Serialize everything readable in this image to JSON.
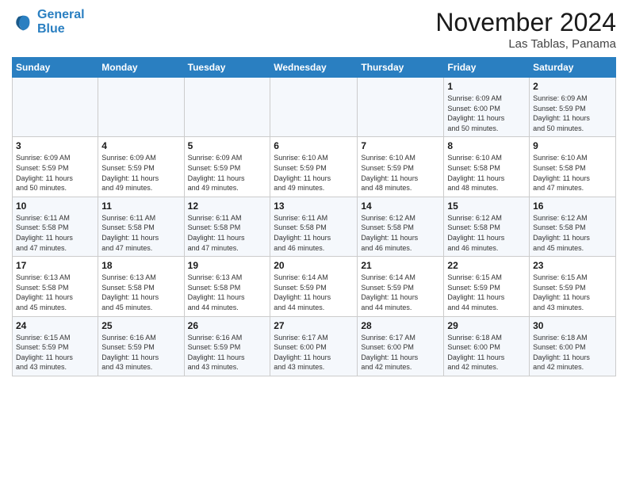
{
  "logo": {
    "line1": "General",
    "line2": "Blue"
  },
  "title": "November 2024",
  "location": "Las Tablas, Panama",
  "days_header": [
    "Sunday",
    "Monday",
    "Tuesday",
    "Wednesday",
    "Thursday",
    "Friday",
    "Saturday"
  ],
  "weeks": [
    [
      {
        "num": "",
        "info": ""
      },
      {
        "num": "",
        "info": ""
      },
      {
        "num": "",
        "info": ""
      },
      {
        "num": "",
        "info": ""
      },
      {
        "num": "",
        "info": ""
      },
      {
        "num": "1",
        "info": "Sunrise: 6:09 AM\nSunset: 6:00 PM\nDaylight: 11 hours\nand 50 minutes."
      },
      {
        "num": "2",
        "info": "Sunrise: 6:09 AM\nSunset: 5:59 PM\nDaylight: 11 hours\nand 50 minutes."
      }
    ],
    [
      {
        "num": "3",
        "info": "Sunrise: 6:09 AM\nSunset: 5:59 PM\nDaylight: 11 hours\nand 50 minutes."
      },
      {
        "num": "4",
        "info": "Sunrise: 6:09 AM\nSunset: 5:59 PM\nDaylight: 11 hours\nand 49 minutes."
      },
      {
        "num": "5",
        "info": "Sunrise: 6:09 AM\nSunset: 5:59 PM\nDaylight: 11 hours\nand 49 minutes."
      },
      {
        "num": "6",
        "info": "Sunrise: 6:10 AM\nSunset: 5:59 PM\nDaylight: 11 hours\nand 49 minutes."
      },
      {
        "num": "7",
        "info": "Sunrise: 6:10 AM\nSunset: 5:59 PM\nDaylight: 11 hours\nand 48 minutes."
      },
      {
        "num": "8",
        "info": "Sunrise: 6:10 AM\nSunset: 5:58 PM\nDaylight: 11 hours\nand 48 minutes."
      },
      {
        "num": "9",
        "info": "Sunrise: 6:10 AM\nSunset: 5:58 PM\nDaylight: 11 hours\nand 47 minutes."
      }
    ],
    [
      {
        "num": "10",
        "info": "Sunrise: 6:11 AM\nSunset: 5:58 PM\nDaylight: 11 hours\nand 47 minutes."
      },
      {
        "num": "11",
        "info": "Sunrise: 6:11 AM\nSunset: 5:58 PM\nDaylight: 11 hours\nand 47 minutes."
      },
      {
        "num": "12",
        "info": "Sunrise: 6:11 AM\nSunset: 5:58 PM\nDaylight: 11 hours\nand 47 minutes."
      },
      {
        "num": "13",
        "info": "Sunrise: 6:11 AM\nSunset: 5:58 PM\nDaylight: 11 hours\nand 46 minutes."
      },
      {
        "num": "14",
        "info": "Sunrise: 6:12 AM\nSunset: 5:58 PM\nDaylight: 11 hours\nand 46 minutes."
      },
      {
        "num": "15",
        "info": "Sunrise: 6:12 AM\nSunset: 5:58 PM\nDaylight: 11 hours\nand 46 minutes."
      },
      {
        "num": "16",
        "info": "Sunrise: 6:12 AM\nSunset: 5:58 PM\nDaylight: 11 hours\nand 45 minutes."
      }
    ],
    [
      {
        "num": "17",
        "info": "Sunrise: 6:13 AM\nSunset: 5:58 PM\nDaylight: 11 hours\nand 45 minutes."
      },
      {
        "num": "18",
        "info": "Sunrise: 6:13 AM\nSunset: 5:58 PM\nDaylight: 11 hours\nand 45 minutes."
      },
      {
        "num": "19",
        "info": "Sunrise: 6:13 AM\nSunset: 5:58 PM\nDaylight: 11 hours\nand 44 minutes."
      },
      {
        "num": "20",
        "info": "Sunrise: 6:14 AM\nSunset: 5:59 PM\nDaylight: 11 hours\nand 44 minutes."
      },
      {
        "num": "21",
        "info": "Sunrise: 6:14 AM\nSunset: 5:59 PM\nDaylight: 11 hours\nand 44 minutes."
      },
      {
        "num": "22",
        "info": "Sunrise: 6:15 AM\nSunset: 5:59 PM\nDaylight: 11 hours\nand 44 minutes."
      },
      {
        "num": "23",
        "info": "Sunrise: 6:15 AM\nSunset: 5:59 PM\nDaylight: 11 hours\nand 43 minutes."
      }
    ],
    [
      {
        "num": "24",
        "info": "Sunrise: 6:15 AM\nSunset: 5:59 PM\nDaylight: 11 hours\nand 43 minutes."
      },
      {
        "num": "25",
        "info": "Sunrise: 6:16 AM\nSunset: 5:59 PM\nDaylight: 11 hours\nand 43 minutes."
      },
      {
        "num": "26",
        "info": "Sunrise: 6:16 AM\nSunset: 5:59 PM\nDaylight: 11 hours\nand 43 minutes."
      },
      {
        "num": "27",
        "info": "Sunrise: 6:17 AM\nSunset: 6:00 PM\nDaylight: 11 hours\nand 43 minutes."
      },
      {
        "num": "28",
        "info": "Sunrise: 6:17 AM\nSunset: 6:00 PM\nDaylight: 11 hours\nand 42 minutes."
      },
      {
        "num": "29",
        "info": "Sunrise: 6:18 AM\nSunset: 6:00 PM\nDaylight: 11 hours\nand 42 minutes."
      },
      {
        "num": "30",
        "info": "Sunrise: 6:18 AM\nSunset: 6:00 PM\nDaylight: 11 hours\nand 42 minutes."
      }
    ]
  ]
}
